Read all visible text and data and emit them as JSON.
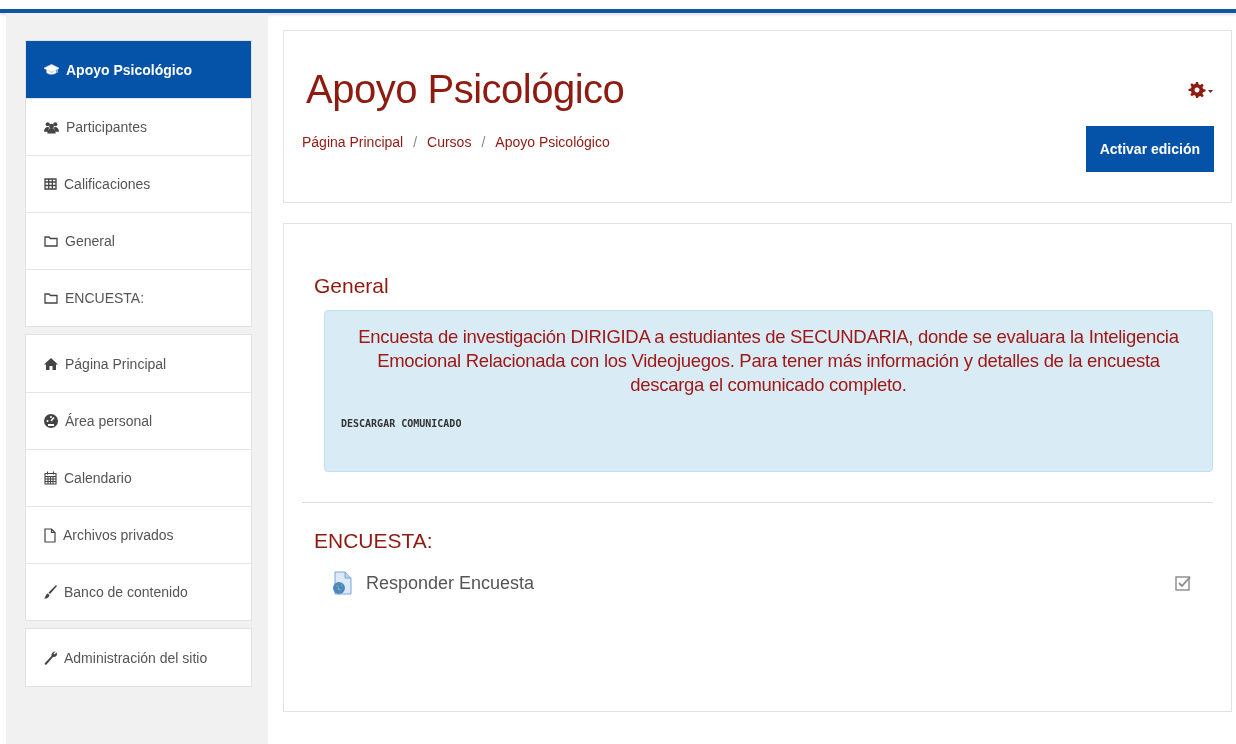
{
  "sidebar": {
    "groups": [
      {
        "items": [
          {
            "label": "Apoyo Psicológico",
            "selected": true
          },
          {
            "label": "Participantes",
            "selected": false
          },
          {
            "label": "Calificaciones",
            "selected": false
          },
          {
            "label": "General",
            "selected": false
          },
          {
            "label": "ENCUESTA:",
            "selected": false
          }
        ]
      },
      {
        "items": [
          {
            "label": "Página Principal",
            "selected": false
          },
          {
            "label": "Área personal",
            "selected": false
          },
          {
            "label": "Calendario",
            "selected": false
          },
          {
            "label": "Archivos privados",
            "selected": false
          },
          {
            "label": "Banco de contenido",
            "selected": false
          }
        ]
      },
      {
        "items": [
          {
            "label": "Administración del sitio",
            "selected": false
          }
        ]
      }
    ]
  },
  "header": {
    "title": "Apoyo Psicológico",
    "breadcrumb": [
      {
        "kind": "link",
        "text": "Página Principal"
      },
      {
        "kind": "separator",
        "text": "/"
      },
      {
        "kind": "link",
        "text": "Cursos"
      },
      {
        "kind": "separator",
        "text": "/"
      },
      {
        "kind": "link",
        "text": "Apoyo Psicológico"
      }
    ],
    "button": "Activar edición"
  },
  "sections": [
    {
      "title": "General",
      "summary": "Encuesta de investigación DIRIGIDA a estudiantes de SECUNDARIA, donde se evaluara la Inteligencia Emocional Relacionada con los Videojuegos. Para tener más información y detalles de la encuesta descarga el comunicado completo.",
      "link": "DESCARGAR COMUNICADO"
    },
    {
      "title": "ENCUESTA:",
      "activities": [
        {
          "label": "Responder Encuesta",
          "checked": true
        }
      ]
    }
  ]
}
